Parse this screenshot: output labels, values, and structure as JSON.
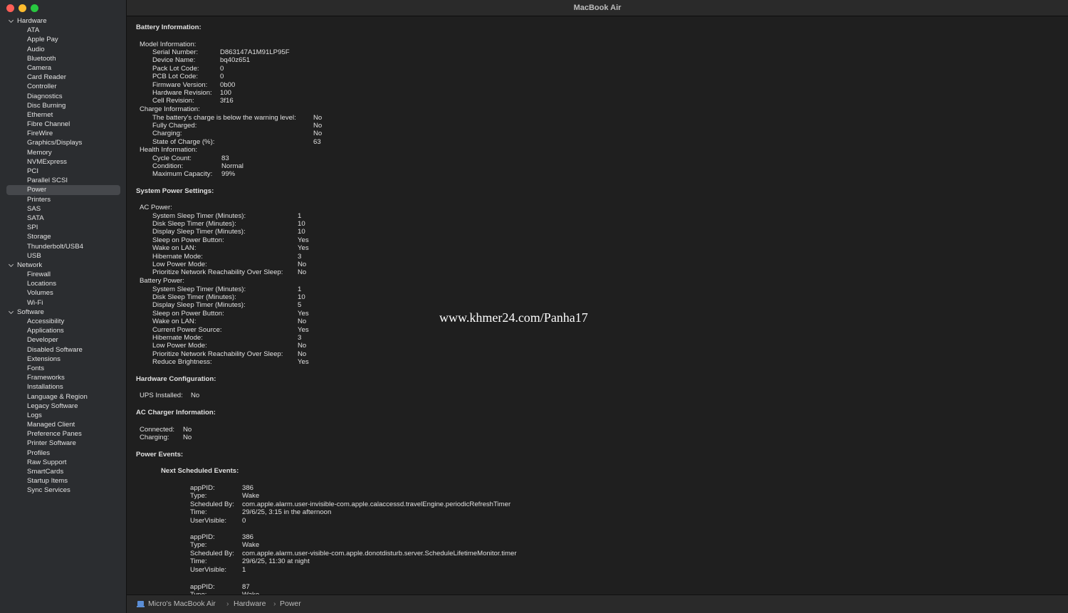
{
  "window": {
    "title": "MacBook Air"
  },
  "sidebar": {
    "categories": [
      {
        "label": "Hardware",
        "items": [
          "ATA",
          "Apple Pay",
          "Audio",
          "Bluetooth",
          "Camera",
          "Card Reader",
          "Controller",
          "Diagnostics",
          "Disc Burning",
          "Ethernet",
          "Fibre Channel",
          "FireWire",
          "Graphics/Displays",
          "Memory",
          "NVMExpress",
          "PCI",
          "Parallel SCSI",
          "Power",
          "Printers",
          "SAS",
          "SATA",
          "SPI",
          "Storage",
          "Thunderbolt/USB4",
          "USB"
        ]
      },
      {
        "label": "Network",
        "items": [
          "Firewall",
          "Locations",
          "Volumes",
          "Wi-Fi"
        ]
      },
      {
        "label": "Software",
        "items": [
          "Accessibility",
          "Applications",
          "Developer",
          "Disabled Software",
          "Extensions",
          "Fonts",
          "Frameworks",
          "Installations",
          "Language & Region",
          "Legacy Software",
          "Logs",
          "Managed Client",
          "Preference Panes",
          "Printer Software",
          "Profiles",
          "Raw Support",
          "SmartCards",
          "Startup Items",
          "Sync Services"
        ]
      }
    ],
    "selected": "Power"
  },
  "content": {
    "battery_header": "Battery Information:",
    "model_header": "Model Information:",
    "model": [
      [
        "Serial Number:",
        "D863147A1M91LP95F"
      ],
      [
        "Device Name:",
        "bq40z651"
      ],
      [
        "Pack Lot Code:",
        "0"
      ],
      [
        "PCB Lot Code:",
        "0"
      ],
      [
        "Firmware Version:",
        "0b00"
      ],
      [
        "Hardware Revision:",
        "100"
      ],
      [
        "Cell Revision:",
        "3f16"
      ]
    ],
    "charge_header": "Charge Information:",
    "charge": [
      [
        "The battery's charge is below the warning level:",
        "No"
      ],
      [
        "Fully Charged:",
        "No"
      ],
      [
        "Charging:",
        "No"
      ],
      [
        "State of Charge (%):",
        "63"
      ]
    ],
    "health_header": "Health Information:",
    "health": [
      [
        "Cycle Count:",
        "83"
      ],
      [
        "Condition:",
        "Normal"
      ],
      [
        "Maximum Capacity:",
        "99%"
      ]
    ],
    "power_settings_header": "System Power Settings:",
    "ac_header": "AC Power:",
    "ac": [
      [
        "System Sleep Timer (Minutes):",
        "1"
      ],
      [
        "Disk Sleep Timer (Minutes):",
        "10"
      ],
      [
        "Display Sleep Timer (Minutes):",
        "10"
      ],
      [
        "Sleep on Power Button:",
        "Yes"
      ],
      [
        "Wake on LAN:",
        "Yes"
      ],
      [
        "Hibernate Mode:",
        "3"
      ],
      [
        "Low Power Mode:",
        "No"
      ],
      [
        "Prioritize Network Reachability Over Sleep:",
        "No"
      ]
    ],
    "batt_power_header": "Battery Power:",
    "batt_power": [
      [
        "System Sleep Timer (Minutes):",
        "1"
      ],
      [
        "Disk Sleep Timer (Minutes):",
        "10"
      ],
      [
        "Display Sleep Timer (Minutes):",
        "5"
      ],
      [
        "Sleep on Power Button:",
        "Yes"
      ],
      [
        "Wake on LAN:",
        "No"
      ],
      [
        "Current Power Source:",
        "Yes"
      ],
      [
        "Hibernate Mode:",
        "3"
      ],
      [
        "Low Power Mode:",
        "No"
      ],
      [
        "Prioritize Network Reachability Over Sleep:",
        "No"
      ],
      [
        "Reduce Brightness:",
        "Yes"
      ]
    ],
    "hw_config_header": "Hardware Configuration:",
    "hw_config": [
      [
        "UPS Installed:",
        "No"
      ]
    ],
    "ac_charger_header": "AC Charger Information:",
    "ac_charger": [
      [
        "Connected:",
        "No"
      ],
      [
        "Charging:",
        "No"
      ]
    ],
    "power_events_header": "Power Events:",
    "next_events_header": "Next Scheduled Events:",
    "events": [
      [
        [
          "appPID:",
          "386"
        ],
        [
          "Type:",
          "Wake"
        ],
        [
          "Scheduled By:",
          "com.apple.alarm.user-invisible-com.apple.calaccessd.travelEngine.periodicRefreshTimer"
        ],
        [
          "Time:",
          "29/6/25, 3:15 in the afternoon"
        ],
        [
          "UserVisible:",
          "0"
        ]
      ],
      [
        [
          "appPID:",
          "386"
        ],
        [
          "Type:",
          "Wake"
        ],
        [
          "Scheduled By:",
          "com.apple.alarm.user-visible-com.apple.donotdisturb.server.ScheduleLifetimeMonitor.timer"
        ],
        [
          "Time:",
          "29/6/25, 11:30 at night"
        ],
        [
          "UserVisible:",
          "1"
        ]
      ],
      [
        [
          "appPID:",
          "87"
        ],
        [
          "Type:",
          "Wake"
        ]
      ]
    ]
  },
  "statusbar": {
    "crumbs": [
      "Micro's MacBook Air",
      "Hardware",
      "Power"
    ],
    "separator": "›"
  },
  "watermark": "www.khmer24.com/Panha17"
}
